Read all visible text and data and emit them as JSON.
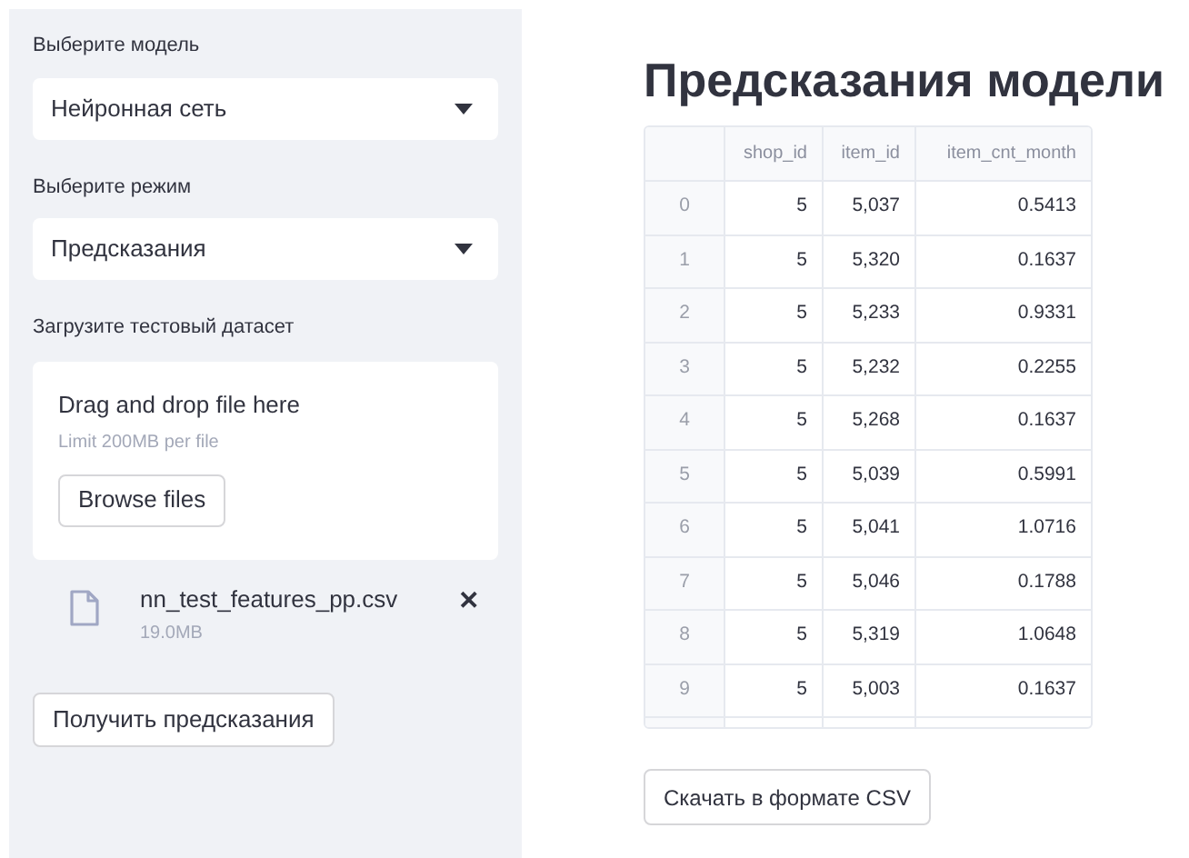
{
  "sidebar": {
    "model_select": {
      "label": "Выберите модель",
      "value": "Нейронная сеть"
    },
    "mode_select": {
      "label": "Выберите режим",
      "value": "Предсказания"
    },
    "uploader": {
      "label": "Загрузите тестовый датасет",
      "drop_text": "Drag and drop file here",
      "limit_text": "Limit 200MB per file",
      "browse_button": "Browse files",
      "file": {
        "name": "nn_test_features_pp.csv",
        "size": "19.0MB",
        "remove_icon": "✕"
      }
    },
    "predict_button": "Получить предсказания"
  },
  "main": {
    "title": "Предсказания модели",
    "table": {
      "columns": [
        "",
        "shop_id",
        "item_id",
        "item_cnt_month"
      ],
      "rows": [
        [
          "0",
          "5",
          "5,037",
          "0.5413"
        ],
        [
          "1",
          "5",
          "5,320",
          "0.1637"
        ],
        [
          "2",
          "5",
          "5,233",
          "0.9331"
        ],
        [
          "3",
          "5",
          "5,232",
          "0.2255"
        ],
        [
          "4",
          "5",
          "5,268",
          "0.1637"
        ],
        [
          "5",
          "5",
          "5,039",
          "0.5991"
        ],
        [
          "6",
          "5",
          "5,041",
          "1.0716"
        ],
        [
          "7",
          "5",
          "5,046",
          "0.1788"
        ],
        [
          "8",
          "5",
          "5,319",
          "1.0648"
        ],
        [
          "9",
          "5",
          "5,003",
          "0.1637"
        ]
      ]
    },
    "download_button": "Скачать в формате CSV"
  }
}
